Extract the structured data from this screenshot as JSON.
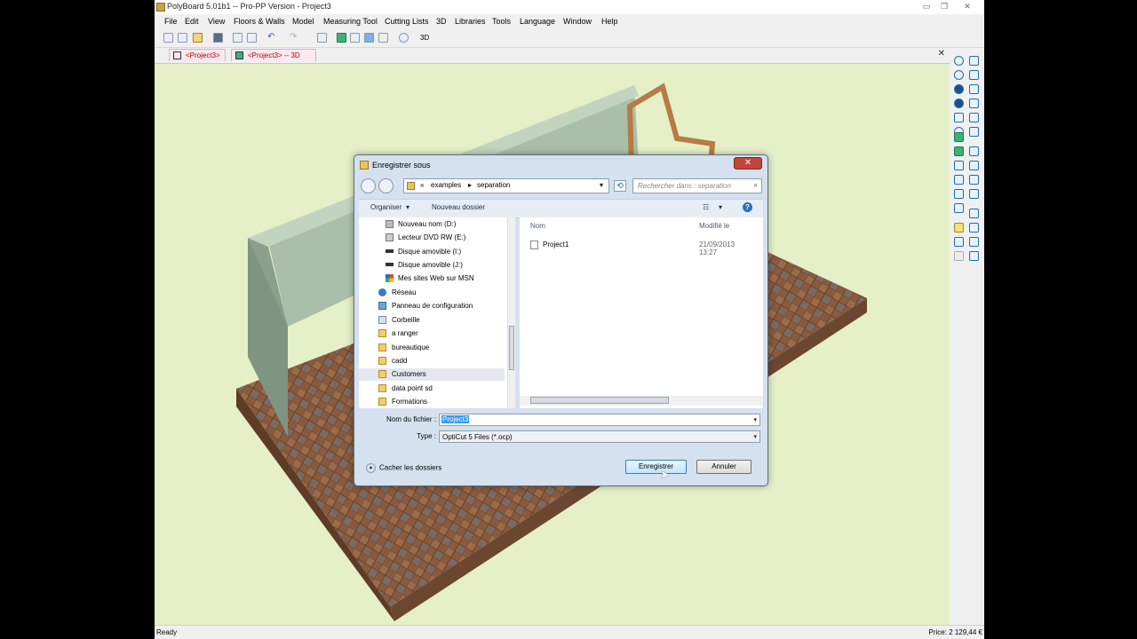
{
  "app": {
    "title": "PolyBoard 5.01b1 -- Pro-PP Version - Project3",
    "menu": [
      "File",
      "Edit",
      "View",
      "Floors & Walls",
      "Model",
      "Measuring Tool",
      "Cutting Lists",
      "3D",
      "Libraries",
      "Tools",
      "Language",
      "Window",
      "Help"
    ],
    "tabs": [
      "<Project3>",
      "<Project3> -- 3D"
    ],
    "status": "Ready",
    "price": "Price: 2 129,44 €"
  },
  "dialog": {
    "title": "Enregistrer sous",
    "close": "✕",
    "breadcrumb": [
      "«",
      "examples",
      "separation"
    ],
    "search_placeholder": "Rechercher dans : separation",
    "organize": "Organiser",
    "new_folder": "Nouveau dossier",
    "nav_items": [
      {
        "label": "Nouveau nom (D:)",
        "icon": "drive-icon"
      },
      {
        "label": "Lecteur DVD RW (E:)",
        "icon": "dvd-drive-icon"
      },
      {
        "label": "Disque amovible (I:)",
        "icon": "removable-drive-icon"
      },
      {
        "label": "Disque amovible (J:)",
        "icon": "removable-drive-icon"
      },
      {
        "label": "Mes sites Web sur MSN",
        "icon": "msn-icon"
      },
      {
        "label": "Réseau",
        "icon": "network-icon"
      },
      {
        "label": "Panneau de configuration",
        "icon": "control-panel-icon"
      },
      {
        "label": "Corbeille",
        "icon": "recycle-bin-icon"
      },
      {
        "label": "a ranger",
        "icon": "folder-icon"
      },
      {
        "label": "bureautique",
        "icon": "folder-icon"
      },
      {
        "label": "cadd",
        "icon": "folder-icon"
      },
      {
        "label": "Customers",
        "icon": "folder-icon"
      },
      {
        "label": "data point sd",
        "icon": "folder-icon"
      },
      {
        "label": "Formations",
        "icon": "folder-icon"
      }
    ],
    "columns": {
      "name": "Nom",
      "modified": "Modifié le"
    },
    "files": [
      {
        "name": "Project1",
        "modified": "21/09/2013 13:27"
      }
    ],
    "filename_label": "Nom du fichier :",
    "filename_value": "Project3",
    "type_label": "Type :",
    "type_value": "OptiCut 5 Files (*.ocp)",
    "hide_folders": "Cacher les dossiers",
    "save": "Enregistrer",
    "cancel": "Annuler"
  },
  "colors": {
    "viewport": "#e5efc8",
    "wall": "#8ea592",
    "floor": "#8a5a3c",
    "accent": "#3399ff"
  }
}
